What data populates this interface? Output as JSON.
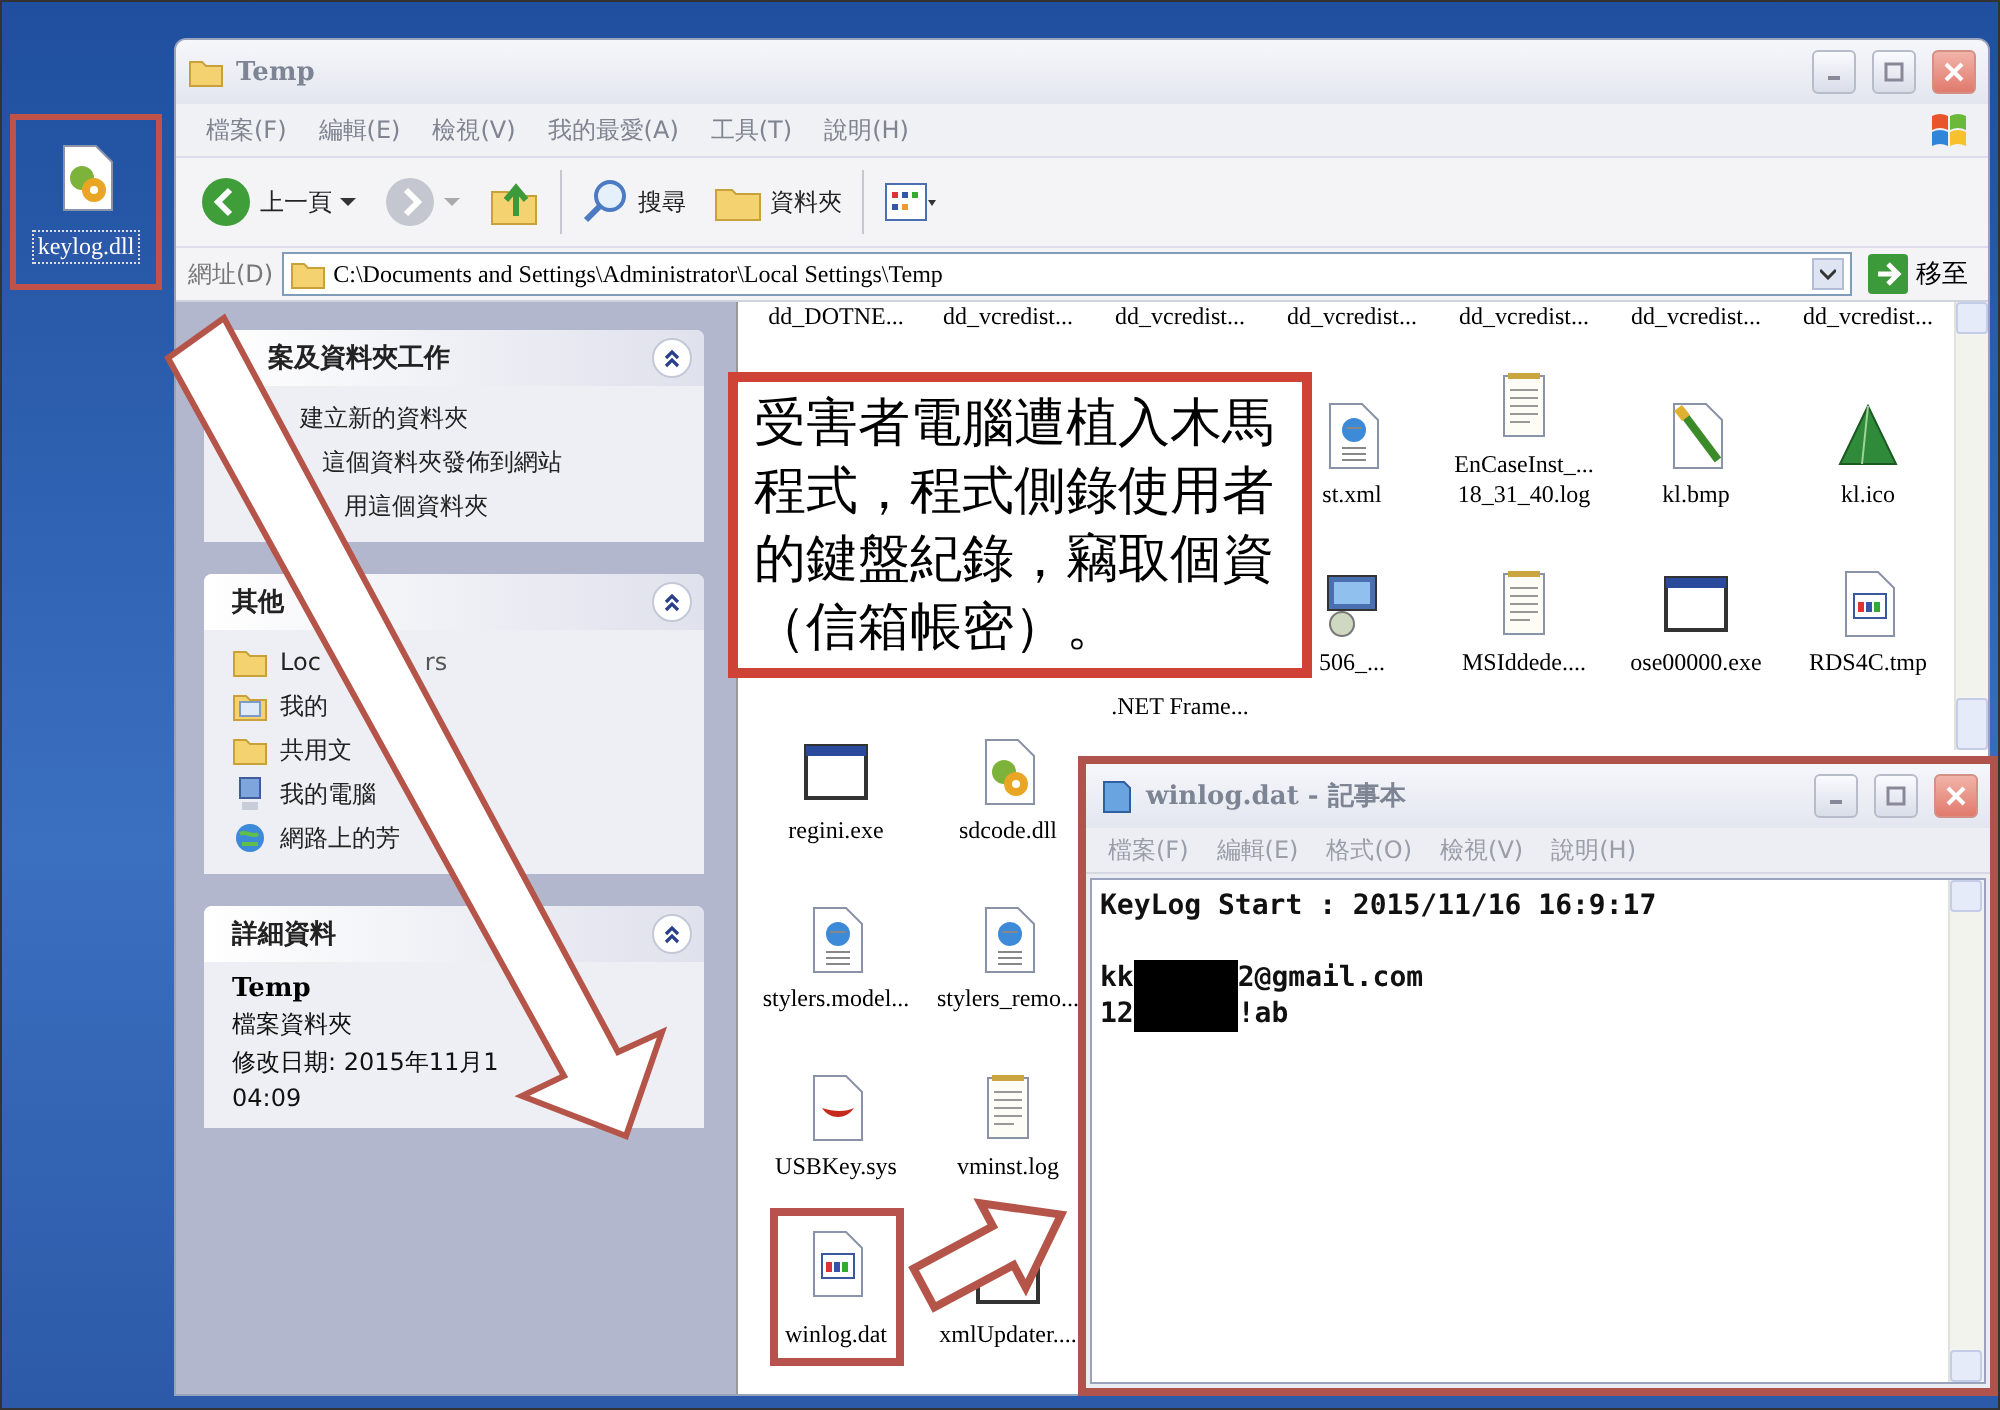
{
  "desktop": {
    "icon": {
      "label": "keylog.dll",
      "kind": "dll",
      "highlighted": true
    }
  },
  "explorer": {
    "title": "Temp",
    "menu": [
      "檔案(F)",
      "編輯(E)",
      "檢視(V)",
      "我的最愛(A)",
      "工具(T)",
      "說明(H)"
    ],
    "toolbar": {
      "back": "上一頁",
      "search": "搜尋",
      "folders": "資料夾"
    },
    "address": {
      "label": "網址(D)",
      "value": "C:\\Documents and Settings\\Administrator\\Local Settings\\Temp",
      "go": "移至"
    },
    "sections": [
      {
        "kind": "links",
        "title": "案及資料夾工作",
        "expanded": true,
        "items": [
          {
            "text": "建立新的資料夾"
          },
          {
            "text": "這個資料夾發佈到網站"
          },
          {
            "text": "用這個資料夾"
          }
        ]
      },
      {
        "kind": "links",
        "title": "其他",
        "expanded": true,
        "items": [
          {
            "kind": "folder",
            "text": "Loc",
            "tail": "rs"
          },
          {
            "kind": "documents",
            "text": "我的"
          },
          {
            "kind": "folder",
            "text": "共用文"
          },
          {
            "kind": "computer",
            "text": "我的電腦"
          },
          {
            "kind": "network",
            "text": "網路上的芳"
          }
        ]
      },
      {
        "kind": "details",
        "title": "詳細資料",
        "expanded": true,
        "name": "Temp",
        "lines": [
          "檔案資料夾",
          "修改日期: 2015年11月1",
          "04:09"
        ]
      }
    ],
    "files": [
      {
        "kind": "leading",
        "items": [
          {
            "kind": "cut",
            "label": "dd_DOTNE..."
          },
          {
            "kind": "cut",
            "label": "dd_vcredist..."
          },
          {
            "kind": "cut",
            "label": "dd_vcredist..."
          },
          {
            "kind": "cut",
            "label": "dd_vcredist..."
          },
          {
            "kind": "cut",
            "label": "dd_vcredist..."
          },
          {
            "kind": "cut",
            "label": "dd_vcredist..."
          },
          {
            "kind": "cut",
            "label": "dd_vcredist..."
          }
        ]
      },
      {
        "kind": "trailing",
        "items": [
          {
            "kind": "xml",
            "label": "st.xml"
          },
          {
            "kind": "log",
            "label": "EnCaseInst_... 18_31_40.log"
          },
          {
            "kind": "bmp",
            "label": "kl.bmp"
          },
          {
            "kind": "ico",
            "label": "kl.ico"
          }
        ]
      },
      {
        "kind": "trailing",
        "items": [
          {
            "kind": "covered",
            "label": ".NET Frame..."
          },
          {
            "kind": "installer",
            "label": "506_..."
          },
          {
            "kind": "log",
            "label": "MSIddede...."
          },
          {
            "kind": "exe",
            "label": "ose00000.exe"
          },
          {
            "kind": "tmp",
            "label": "RDS4C.tmp"
          }
        ]
      },
      {
        "kind": "leading",
        "items": [
          {
            "kind": "exe",
            "label": "regini.exe"
          },
          {
            "kind": "dll",
            "label": "sdcode.dll"
          }
        ]
      },
      {
        "kind": "leading",
        "items": [
          {
            "kind": "xml",
            "label": "stylers.model..."
          },
          {
            "kind": "xml",
            "label": "stylers_remo..."
          }
        ]
      },
      {
        "kind": "leading",
        "items": [
          {
            "kind": "sys",
            "label": "USBKey.sys"
          },
          {
            "kind": "log",
            "label": "vminst.log"
          }
        ]
      },
      {
        "kind": "leading",
        "items": [
          {
            "kind": "tmp",
            "label": "winlog.dat",
            "highlighted": true
          },
          {
            "kind": "exe",
            "label": "xmlUpdater...."
          }
        ]
      }
    ]
  },
  "callout": {
    "text": "受害者電腦遭植入木馬程式，程式側錄使用者的鍵盤紀錄，竊取個資（信箱帳密）。"
  },
  "notepad": {
    "title": "winlog.dat - 記事本",
    "menu": [
      "檔案(F)",
      "編輯(E)",
      "格式(O)",
      "檢視(V)",
      "說明(H)"
    ],
    "lines": [
      {
        "segments": [
          {
            "kind": "text",
            "text": "KeyLog Start : 2015/11/16 16:9:17"
          }
        ]
      },
      {
        "segments": [
          {
            "kind": "text",
            "text": "kk"
          },
          {
            "kind": "redaction"
          },
          {
            "kind": "text",
            "text": "2@gmail.com"
          }
        ]
      },
      {
        "segments": [
          {
            "kind": "text",
            "text": "12"
          },
          {
            "kind": "redaction"
          },
          {
            "kind": "text",
            "text": "!ab"
          }
        ]
      }
    ]
  }
}
